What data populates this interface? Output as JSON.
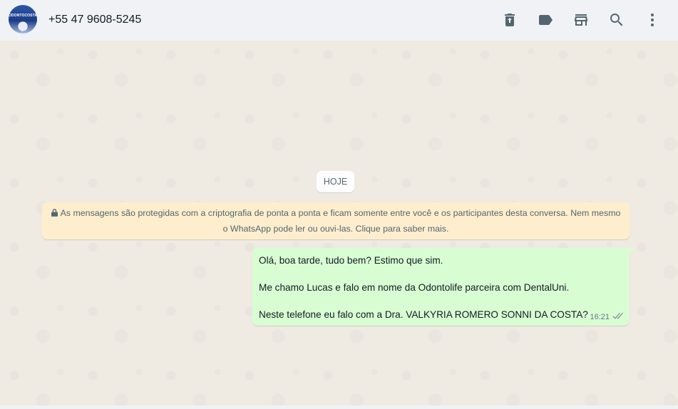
{
  "header": {
    "avatar_text": "ODONTOCOSTA",
    "contact": "+55 47 9608-5245",
    "icons": [
      "delete-icon",
      "label-icon",
      "store-icon",
      "search-icon",
      "menu-icon"
    ]
  },
  "chat": {
    "date_pill": "HOJE",
    "encryption_notice": {
      "line1": "As mensagens são protegidas com a criptografia de ponta a ponta e ficam somente entre você e os participantes desta conversa. Nem mesmo",
      "line2": "o WhatsApp pode ler ou ouvi-las. Clique para saber mais."
    },
    "message": {
      "line1": "Olá, boa tarde, tudo bem? Estimo que sim.",
      "line2": "Me chamo Lucas e falo em nome da Odontolife parceira com DentalUni.",
      "line3": "Neste telefone eu falo com a Dra. VALKYRIA ROMERO SONNI DA COSTA?",
      "time": "16:21",
      "status": "read"
    }
  },
  "colors": {
    "header_bg": "#f0f2f5",
    "chat_bg": "#efeae2",
    "outgoing_bubble": "#d9fdd3",
    "encryption_bg": "#ffeecd",
    "icon": "#54656f",
    "read_ticks": "#8696a0"
  }
}
